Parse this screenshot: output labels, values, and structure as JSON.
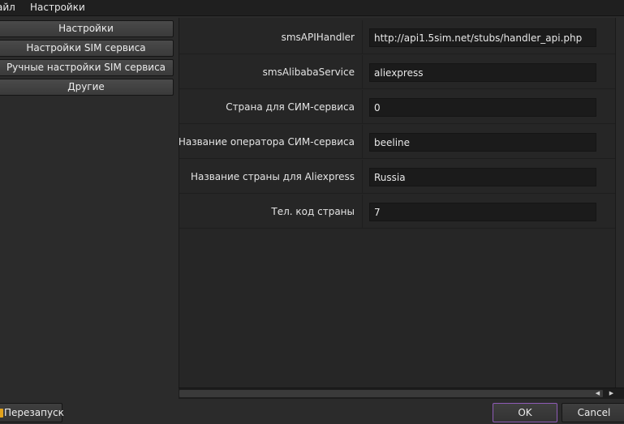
{
  "menubar": {
    "file_label": "айл",
    "settings_label": "Настройки"
  },
  "sidebar": {
    "items": [
      {
        "label": "Настройки"
      },
      {
        "label": "Настройки SIM сервиса"
      },
      {
        "label": "Ручные настройки SIM сервиса"
      },
      {
        "label": "Другие"
      }
    ]
  },
  "form": {
    "rows": [
      {
        "label": "smsAPIHandler",
        "value": "http://api1.5sim.net/stubs/handler_api.php"
      },
      {
        "label": "smsAlibabaService",
        "value": "aliexpress"
      },
      {
        "label": "Страна для СИМ-сервиса",
        "value": "0"
      },
      {
        "label": "Название оператора СИМ-сервиса",
        "value": "beeline"
      },
      {
        "label": "Название страны для Aliexpress",
        "value": "Russia"
      },
      {
        "label": "Тел. код страны",
        "value": "7"
      }
    ]
  },
  "footer": {
    "restart_label": "Перезапуск",
    "ok_label": "OK",
    "cancel_label": "Cancel"
  },
  "icons": {
    "restart": "restart-icon",
    "scroll_left": "arrow-left-icon",
    "scroll_right": "arrow-right-icon"
  },
  "colors": {
    "accent_border": "#8e5bb6",
    "restart_icon": "#e1a21c"
  }
}
